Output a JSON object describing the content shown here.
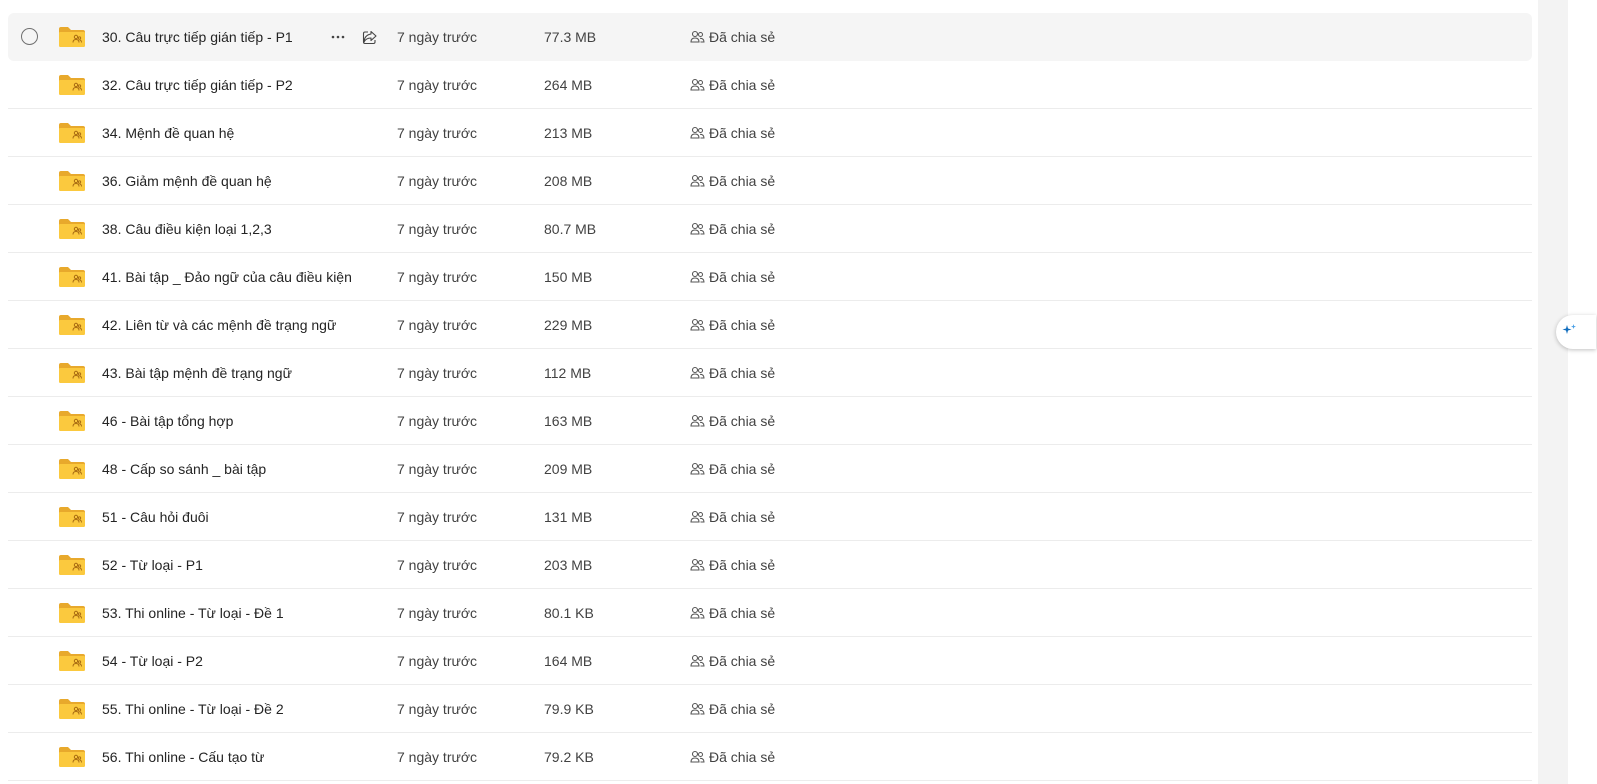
{
  "colors": {
    "folder_back": "#e8a92c",
    "folder_front": "#fbc93e",
    "folder_glyph": "#a86b12",
    "accent": "#0f6cbd"
  },
  "icons": {
    "folder": "shared-folder-icon",
    "more": "more-horizontal-icon",
    "share": "share-icon",
    "shared": "people-icon",
    "select": "selection-circle-icon",
    "side_handle": "copilot-sparkle-icon"
  },
  "files": [
    {
      "name": "30. Câu trực tiếp gián tiếp - P1",
      "modified": "7 ngày trước",
      "size": "77.3 MB",
      "sharing": "Đã chia sẻ"
    },
    {
      "name": "32. Câu trực tiếp gián tiếp - P2",
      "modified": "7 ngày trước",
      "size": "264 MB",
      "sharing": "Đã chia sẻ"
    },
    {
      "name": "34. Mệnh đề quan hệ",
      "modified": "7 ngày trước",
      "size": "213 MB",
      "sharing": "Đã chia sẻ"
    },
    {
      "name": "36. Giảm mệnh đề quan hệ",
      "modified": "7 ngày trước",
      "size": "208 MB",
      "sharing": "Đã chia sẻ"
    },
    {
      "name": "38. Câu điều kiện loại 1,2,3",
      "modified": "7 ngày trước",
      "size": "80.7 MB",
      "sharing": "Đã chia sẻ"
    },
    {
      "name": "41. Bài tập _ Đảo ngữ của câu điều kiện",
      "modified": "7 ngày trước",
      "size": "150 MB",
      "sharing": "Đã chia sẻ"
    },
    {
      "name": "42. Liên từ và các mệnh đề trạng ngữ",
      "modified": "7 ngày trước",
      "size": "229 MB",
      "sharing": "Đã chia sẻ"
    },
    {
      "name": "43. Bài tập mệnh đề trạng ngữ",
      "modified": "7 ngày trước",
      "size": "112 MB",
      "sharing": "Đã chia sẻ"
    },
    {
      "name": "46 - Bài tập tổng hợp",
      "modified": "7 ngày trước",
      "size": "163 MB",
      "sharing": "Đã chia sẻ"
    },
    {
      "name": "48 - Cấp so sánh _ bài tập",
      "modified": "7 ngày trước",
      "size": "209 MB",
      "sharing": "Đã chia sẻ"
    },
    {
      "name": "51 - Câu hỏi đuôi",
      "modified": "7 ngày trước",
      "size": "131 MB",
      "sharing": "Đã chia sẻ"
    },
    {
      "name": "52 - Từ loại - P1",
      "modified": "7 ngày trước",
      "size": "203 MB",
      "sharing": "Đã chia sẻ"
    },
    {
      "name": "53. Thi online - Từ loại - Đề 1",
      "modified": "7 ngày trước",
      "size": "80.1 KB",
      "sharing": "Đã chia sẻ"
    },
    {
      "name": "54 - Từ loại - P2",
      "modified": "7 ngày trước",
      "size": "164 MB",
      "sharing": "Đã chia sẻ"
    },
    {
      "name": "55. Thi online - Từ loại - Đề 2",
      "modified": "7 ngày trước",
      "size": "79.9 KB",
      "sharing": "Đã chia sẻ"
    },
    {
      "name": "56. Thi online - Cấu tạo từ",
      "modified": "7 ngày trước",
      "size": "79.2 KB",
      "sharing": "Đã chia sẻ"
    }
  ]
}
